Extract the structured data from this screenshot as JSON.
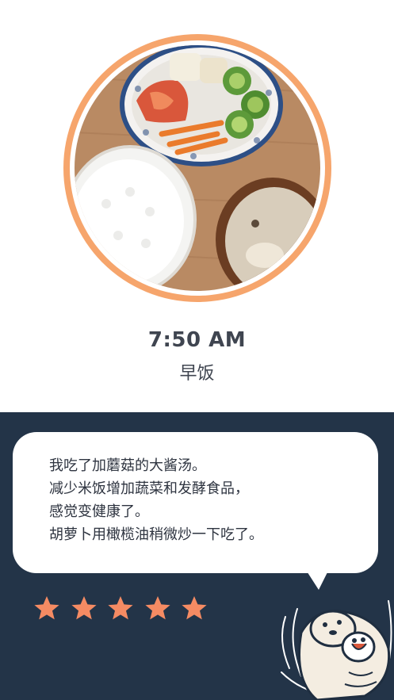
{
  "entry": {
    "time": "7:50 AM",
    "meal": "早饭",
    "photo_icon": "meal-photo",
    "note_lines": [
      "我吃了加蘑菇的大酱汤。",
      "减少米饭增加蔬菜和发酵食品，",
      "感觉变健康了。",
      "胡萝卜用橄榄油稍微炒一下吃了。"
    ],
    "rating": 5,
    "rating_max": 5,
    "mascot_icon": "otter-mascot"
  },
  "colors": {
    "ring": "#f6a56c",
    "star": "#f58b63",
    "bottom_bg": "#233448",
    "text": "#3f4550"
  }
}
